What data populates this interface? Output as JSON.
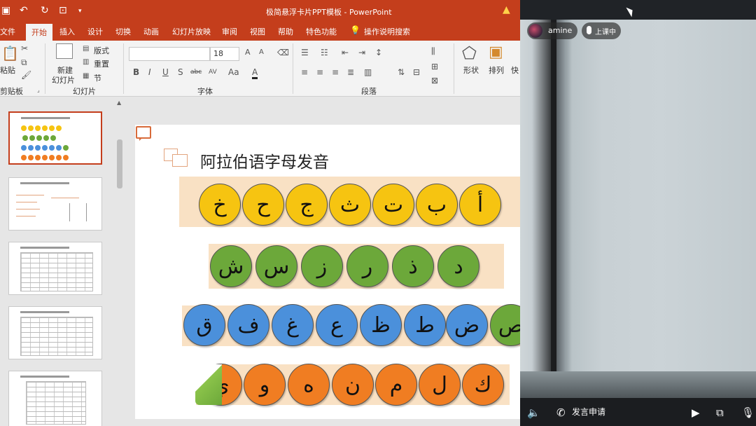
{
  "titlebar": {
    "title": "极简悬浮卡片PPT模板 - PowerPoint",
    "icons": [
      "save-icon",
      "undo-icon",
      "redo-icon",
      "present-icon",
      "customize-icon",
      "warning-icon"
    ]
  },
  "tabs": [
    "文件",
    "开始",
    "插入",
    "设计",
    "切换",
    "动画",
    "幻灯片放映",
    "审阅",
    "视图",
    "帮助",
    "特色功能",
    "操作说明搜索"
  ],
  "active_tab": "开始",
  "ribbon": {
    "clipboard": {
      "paste": "粘贴",
      "label": "剪贴板"
    },
    "slides": {
      "new_slide_line1": "新建",
      "new_slide_line2": "幻灯片",
      "layout": "版式",
      "reset": "重置",
      "section": "节",
      "label": "幻灯片"
    },
    "font": {
      "name_value": "",
      "size_value": "18",
      "label": "字体",
      "format_buttons": [
        "B",
        "I",
        "U",
        "S",
        "abc",
        "AV",
        "Aa",
        "A"
      ]
    },
    "paragraph": {
      "label": "段落"
    },
    "drawing": {
      "shape": "形状",
      "arrange": "排列",
      "quick": "快"
    }
  },
  "thumbnails": {
    "numbers": [
      "",
      "",
      "",
      "",
      ""
    ],
    "selected_index": 0
  },
  "slide": {
    "title": "阿拉伯语字母发音",
    "rows": [
      {
        "color": "yellow",
        "letters": [
          "خ",
          "ح",
          "ج",
          "ث",
          "ت",
          "ب",
          "أ"
        ]
      },
      {
        "color": "green",
        "letters": [
          "ش",
          "س",
          "ز",
          "ر",
          "ذ",
          "د"
        ]
      },
      {
        "color": "blue",
        "letters": [
          "ق",
          "ف",
          "غ",
          "ع",
          "ظ",
          "ط",
          "ض",
          "ص"
        ]
      },
      {
        "color": "orange",
        "letters": [
          "ي",
          "و",
          "ه",
          "ن",
          "م",
          "ل",
          "ك"
        ]
      }
    ],
    "colors": {
      "yellow": "#f6c411",
      "green": "#6ca83a",
      "blue": "#4b90db",
      "orange": "#f07d22",
      "band": "#f9e1c4"
    }
  },
  "video": {
    "username": "amine",
    "status": "上课中",
    "speak_request": "发言申请",
    "icons": [
      "volume-icon",
      "phone-icon",
      "camera-icon",
      "screen-share-icon",
      "mic-icon"
    ]
  }
}
